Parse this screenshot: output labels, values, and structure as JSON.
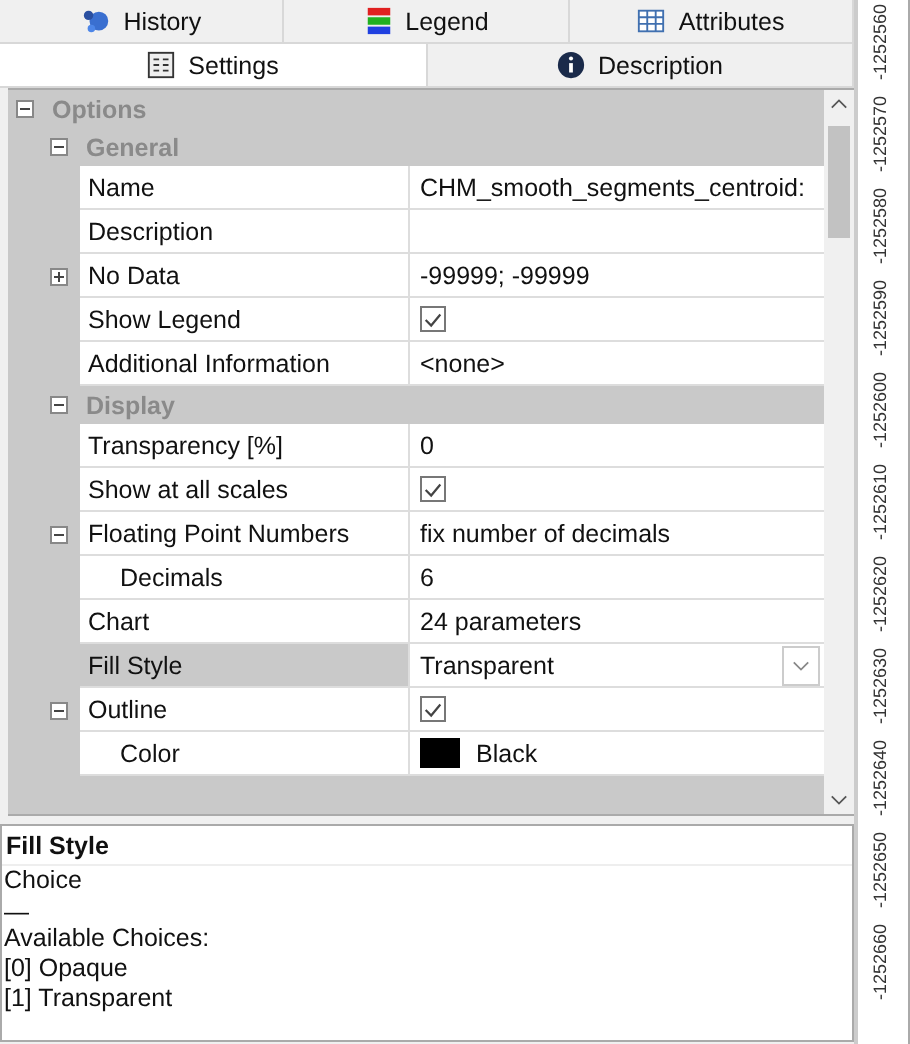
{
  "tabs_top": [
    {
      "label": "History",
      "selected": false
    },
    {
      "label": "Legend",
      "selected": false
    },
    {
      "label": "Attributes",
      "selected": false
    }
  ],
  "tabs_bottom": [
    {
      "label": "Settings",
      "selected": true
    },
    {
      "label": "Description",
      "selected": false
    }
  ],
  "properties": [
    {
      "kind": "category",
      "label": "Options",
      "expanded": true,
      "children": [
        {
          "kind": "category",
          "label": "General",
          "expanded": true,
          "children": [
            {
              "kind": "text",
              "label": "Name",
              "value": "CHM_smooth_segments_centroid:",
              "selected": false
            },
            {
              "kind": "text",
              "label": "Description",
              "selected": false
            },
            {
              "kind": "text",
              "label": "No Data",
              "value": "-99999; -99999",
              "expanded": false,
              "selected": false
            },
            {
              "kind": "checkbox",
              "label": "Show Legend",
              "checked": true,
              "selected": false
            },
            {
              "kind": "text",
              "label": "Additional Information",
              "value": "<none>",
              "selected": false
            }
          ]
        },
        {
          "kind": "category",
          "label": "Display",
          "expanded": true,
          "children": [
            {
              "kind": "text",
              "label": "Transparency [%]",
              "value": "0",
              "selected": false
            },
            {
              "kind": "checkbox",
              "label": "Show at all scales",
              "checked": true,
              "selected": false
            },
            {
              "kind": "text",
              "label": "Floating Point Numbers",
              "value": "fix number of decimals",
              "expanded": true,
              "selected": false,
              "children": [
                {
                  "kind": "text",
                  "label": "Decimals",
                  "value": "6",
                  "selected": false
                }
              ]
            },
            {
              "kind": "text",
              "label": "Chart",
              "value": "24 parameters",
              "selected": false
            },
            {
              "kind": "choice",
              "label": "Fill Style",
              "value": "Transparent",
              "selected": true
            },
            {
              "kind": "checkbox",
              "label": "Outline",
              "checked": true,
              "expanded": true,
              "selected": false,
              "children": [
                {
                  "kind": "color",
                  "label": "Color",
                  "value": "Black",
                  "color": "#000000",
                  "selected": false
                }
              ]
            }
          ]
        }
      ]
    }
  ],
  "help": {
    "title": "Fill Style",
    "type": "Choice",
    "separator": "—",
    "heading": "Available Choices:",
    "choices": [
      "[0] Opaque",
      "[1] Transparent"
    ]
  },
  "ruler_labels": [
    "-1252560",
    "-1252570",
    "-1252580",
    "-1252590",
    "-1252600",
    "-1252610",
    "-1252620",
    "-1252630",
    "-1252640",
    "-1252650",
    "-1252660"
  ]
}
